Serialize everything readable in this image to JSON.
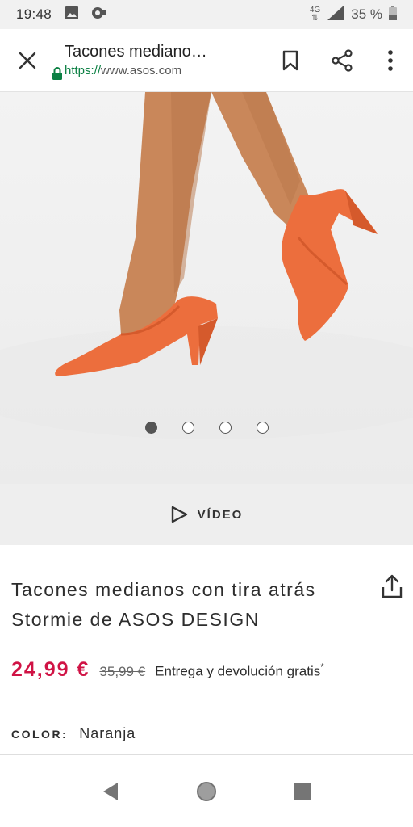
{
  "status_bar": {
    "time": "19:48",
    "network": "4G",
    "battery_text": "35 %"
  },
  "toolbar": {
    "page_title": "Tacones mediano…",
    "url_scheme": "https://",
    "url_host": "www.asos.com"
  },
  "gallery": {
    "image_count": 4,
    "active_index": 0
  },
  "video": {
    "label": "VÍDEO"
  },
  "product": {
    "title_line1": "Tacones medianos con tira atrás",
    "title_line2": "Stormie de ASOS DESIGN",
    "price_current": "24,99 €",
    "price_old": "35,99 €",
    "delivery_text": "Entrega y devolución gratis",
    "delivery_mark": "*",
    "color_label": "COLOR:",
    "color_value": "Naranja"
  },
  "colors": {
    "price_accent": "#d01345",
    "secure_green": "#0b8043",
    "shoe": "#ec6e3d"
  }
}
